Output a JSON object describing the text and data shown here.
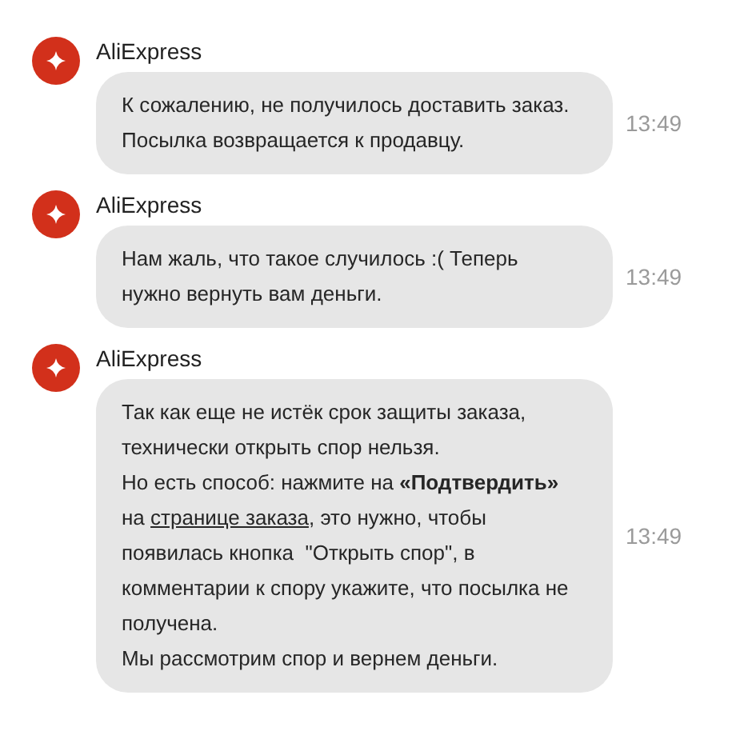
{
  "messages": [
    {
      "sender": "AliExpress",
      "time": "13:49",
      "paragraphs": [
        [
          {
            "kind": "text",
            "text": "К сожалению, не получилось доставить заказ. Посылка возвращается к продавцу."
          }
        ]
      ]
    },
    {
      "sender": "AliExpress",
      "time": "13:49",
      "paragraphs": [
        [
          {
            "kind": "text",
            "text": "Нам жаль, что такое случилось :( Теперь нужно вернуть вам деньги."
          }
        ]
      ]
    },
    {
      "sender": "AliExpress",
      "time": "13:49",
      "paragraphs": [
        [
          {
            "kind": "text",
            "text": "Так как еще не истёк срок защиты заказа, технически открыть спор нельзя."
          }
        ],
        [
          {
            "kind": "text",
            "text": "Но есть способ: нажмите на **«Подтвердить»** на "
          },
          {
            "kind": "link",
            "text": "странице заказа"
          },
          {
            "kind": "text",
            "text": ", это нужно, чтобы появилась кнопка  \"Открыть спор\", в комментарии к спору укажите, что посылка не получена."
          }
        ],
        [
          {
            "kind": "text",
            "text": "Мы рассмотрим спор и вернем деньги."
          }
        ]
      ]
    }
  ]
}
